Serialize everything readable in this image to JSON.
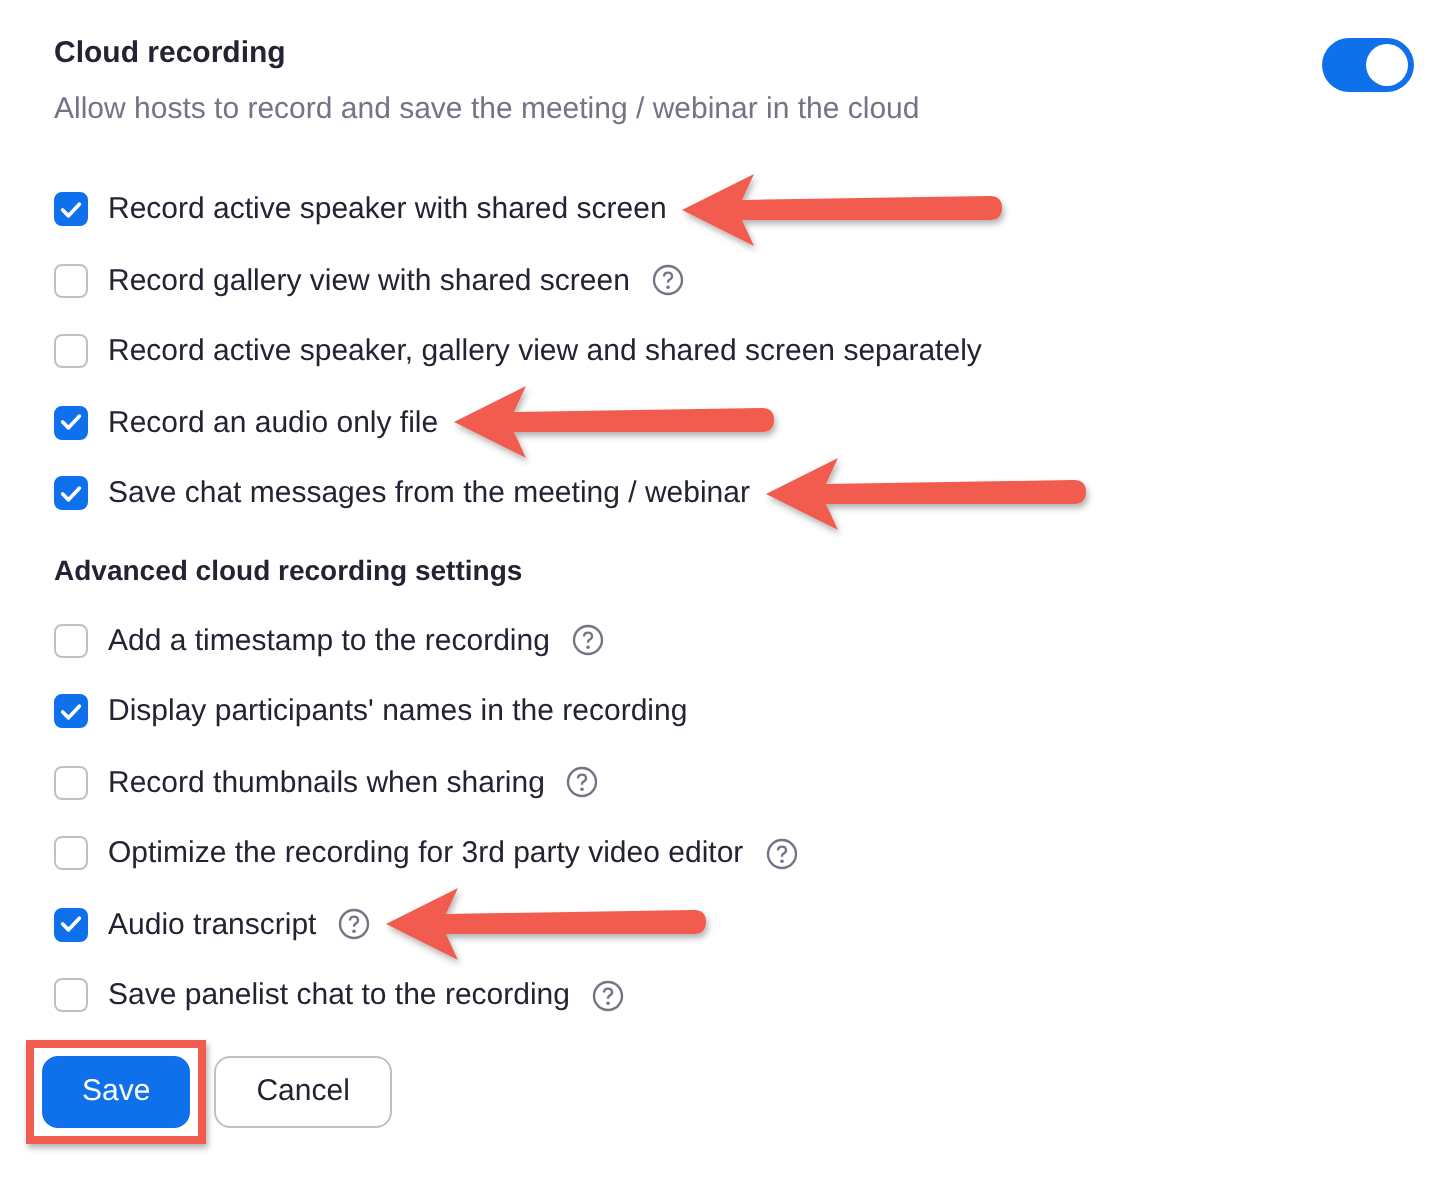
{
  "setting": {
    "title": "Cloud recording",
    "description": "Allow hosts to record and save the meeting / webinar in the cloud",
    "on": true
  },
  "options": [
    {
      "label": "Record active speaker with shared screen",
      "checked": true,
      "help": false,
      "annotated": true
    },
    {
      "label": "Record gallery view with shared screen",
      "checked": false,
      "help": true,
      "annotated": false
    },
    {
      "label": "Record active speaker, gallery view and shared screen separately",
      "checked": false,
      "help": false,
      "annotated": false
    },
    {
      "label": "Record an audio only file",
      "checked": true,
      "help": false,
      "annotated": true
    },
    {
      "label": "Save chat messages from the meeting / webinar",
      "checked": true,
      "help": false,
      "annotated": true
    }
  ],
  "advanced": {
    "heading": "Advanced cloud recording settings",
    "options": [
      {
        "label": "Add a timestamp to the recording",
        "checked": false,
        "help": true,
        "annotated": false
      },
      {
        "label": "Display participants' names in the recording",
        "checked": true,
        "help": false,
        "annotated": false
      },
      {
        "label": "Record thumbnails when sharing",
        "checked": false,
        "help": true,
        "annotated": false
      },
      {
        "label": "Optimize the recording for 3rd party video editor",
        "checked": false,
        "help": true,
        "annotated": false
      },
      {
        "label": "Audio transcript",
        "checked": true,
        "help": true,
        "annotated": true
      },
      {
        "label": "Save panelist chat to the recording",
        "checked": false,
        "help": true,
        "annotated": false
      }
    ]
  },
  "buttons": [
    {
      "label": "Save",
      "kind": "primary",
      "highlighted": true
    },
    {
      "label": "Cancel",
      "kind": "secondary",
      "highlighted": false
    }
  ]
}
